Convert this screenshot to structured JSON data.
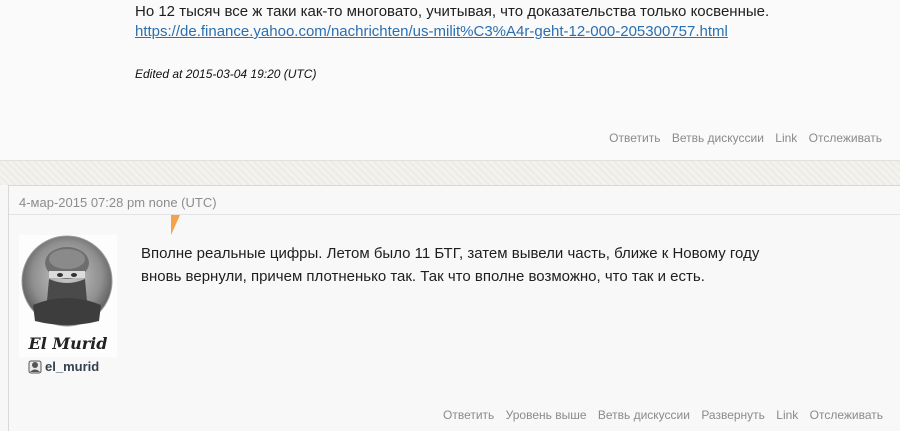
{
  "first_comment": {
    "text": "Но 12 тысяч все ж таки как-то многовато, учитывая, что доказательства только косвенные.",
    "link": "https://de.finance.yahoo.com/nachrichten/us-milit%C3%A4r-geht-12-000-205300757.html",
    "edited": "Edited at 2015-03-04 19:20 (UTC)",
    "actions": [
      "Ответить",
      "Ветвь дискуссии",
      "Link",
      "Отслеживать"
    ]
  },
  "second_comment": {
    "header": "4-мар-2015 07:28 pm none (UTC)",
    "avatar_caption": "El Murid",
    "username": "el_murid",
    "body_line1": "Вполне реальные цифры. Летом было 11 БТГ, затем вывели часть, ближе к Новому году",
    "body_line2": "вновь вернули, причем плотненько так. Так что вполне возможно, что так и есть.",
    "actions": [
      "Ответить",
      "Уровень выше",
      "Ветвь дискуссии",
      "Развернуть",
      "Link",
      "Отслеживать"
    ]
  },
  "colors": {
    "link": "#2a6fb0",
    "action_text": "#8a8a8a",
    "pointer_accent": "#f5a24a",
    "username": "#34404e"
  },
  "icons": {
    "user": "user-head-icon",
    "avatar": "avatar-portrait"
  }
}
